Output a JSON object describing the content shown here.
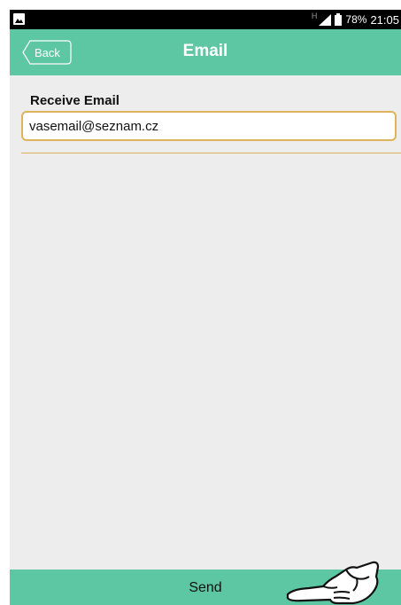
{
  "status_bar": {
    "network_indicator": "H",
    "battery_percent": "78%",
    "time": "21:05",
    "icons": [
      "image-icon",
      "signal-icon",
      "battery-icon"
    ]
  },
  "nav": {
    "back_label": "Back",
    "title": "Email"
  },
  "form": {
    "label": "Receive Email",
    "email_value": "vasemail@seznam.cz"
  },
  "footer": {
    "send_label": "Send",
    "pointer_icon": "pointing-hand-icon"
  },
  "colors": {
    "accent": "#5cc7a2",
    "field_border": "#e0b25a",
    "background": "#ededed",
    "status_bar": "#000000"
  }
}
